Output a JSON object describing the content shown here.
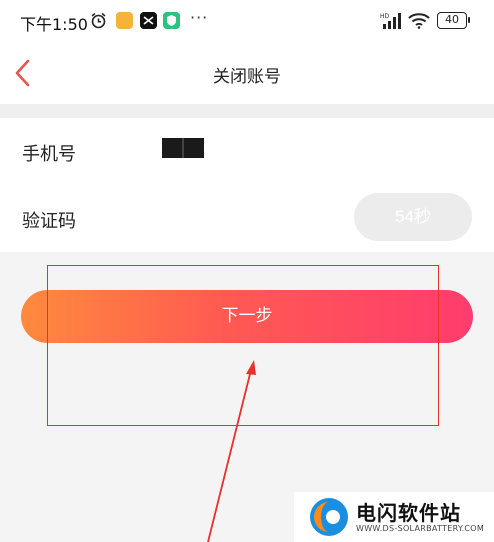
{
  "status_bar": {
    "time": "下午1:50",
    "more": "···",
    "battery": "40",
    "icons": [
      "alarm-icon",
      "app-icon",
      "capcut-icon",
      "shield-app-icon",
      "hd-signal-icon",
      "wifi-icon",
      "battery-icon"
    ]
  },
  "header": {
    "title": "关闭账号",
    "back_icon": "chevron-left-icon"
  },
  "form": {
    "phone_label": "手机号",
    "phone_value": "",
    "code_label": "验证码",
    "code_button": "54秒"
  },
  "actions": {
    "next_label": "下一步"
  },
  "watermark": {
    "title": "电闪软件站",
    "subtitle": "WWW.DS-SOLARBATTERY.COM"
  },
  "colors": {
    "accent_start": "#ff8a3d",
    "accent_end": "#ff3c6e",
    "back_arrow": "#e8544e",
    "annotation": "#e8312c"
  }
}
